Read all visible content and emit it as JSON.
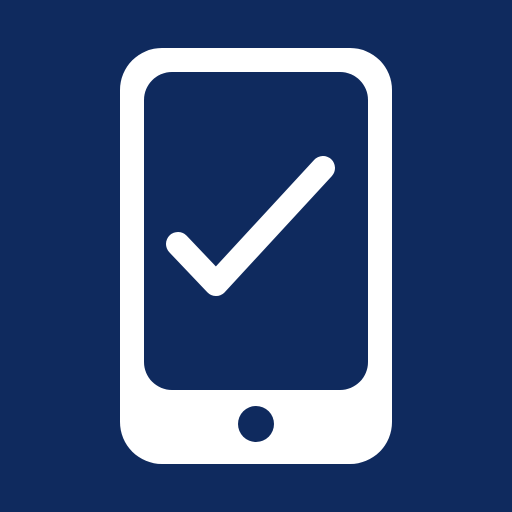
{
  "icon": {
    "name": "phone-checkmark-icon",
    "colors": {
      "background": "#0f2a5e",
      "foreground": "#ffffff"
    }
  }
}
